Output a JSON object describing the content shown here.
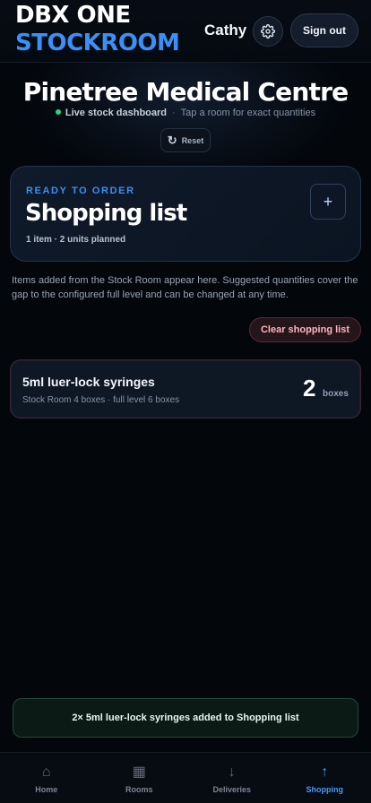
{
  "header": {
    "brand_line1": "DBX ONE",
    "brand_line2": "STOCKROOM",
    "user_name": "Cathy",
    "settings_icon": "gear-icon",
    "sign_out_label": "Sign out"
  },
  "hero": {
    "site_name": "Pinetree Medical Centre",
    "live_label": "Live stock dashboard",
    "hint": "Tap a room for exact quantities",
    "reset_label": "Reset",
    "reset_icon": "refresh-icon"
  },
  "shopping_card": {
    "eyebrow": "READY TO ORDER",
    "title": "Shopping list",
    "meta": "1 item · 2 units planned",
    "add_label": "+"
  },
  "help_text": "Items added from the Stock Room appear here. Suggested quantities cover the gap to the configured full level and can be changed at any time.",
  "clear_label": "Clear shopping list",
  "items": [
    {
      "name": "5ml luer-lock syringes",
      "detail": "Stock Room 4 boxes · full level 6 boxes",
      "quantity": "2",
      "unit": "boxes"
    }
  ],
  "toast": "2× 5ml luer-lock syringes added to Shopping list",
  "tabs": [
    {
      "label": "Home",
      "icon": "home-icon",
      "glyph": "⌂",
      "active": false
    },
    {
      "label": "Rooms",
      "icon": "grid-icon",
      "glyph": "▦",
      "active": false
    },
    {
      "label": "Deliveries",
      "icon": "arrow-down-icon",
      "glyph": "↓",
      "active": false
    },
    {
      "label": "Shopping",
      "icon": "arrow-up-icon",
      "glyph": "↑",
      "active": true
    }
  ],
  "colors": {
    "accent": "#3b8ff5",
    "live": "#2fd27a",
    "danger": "#ffb3bd",
    "background": "#03060b"
  }
}
